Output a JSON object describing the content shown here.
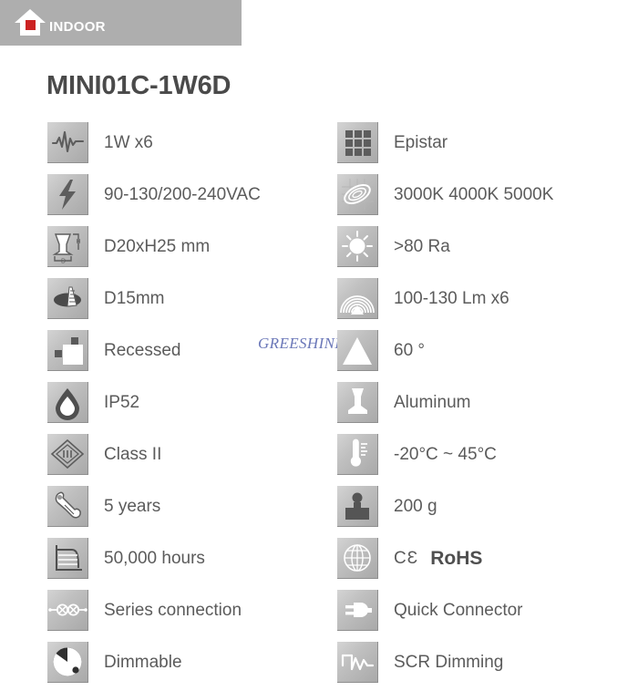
{
  "header": {
    "badge_label": "INDOOR",
    "badge_bg": "#aeaeae",
    "house_fill": "#ffffff",
    "house_accent": "#cc2222"
  },
  "title": "MINI01C-1W6D",
  "watermark": {
    "text": "GREESHINE",
    "color": "#6a77b8"
  },
  "specs": {
    "column_1": [
      {
        "icon": "waveform-icon",
        "label": "1W x6"
      },
      {
        "icon": "lightning-bolt-icon",
        "label": "90-130/200-240VAC"
      },
      {
        "icon": "dimensions-icon",
        "label": "D20xH25 mm"
      },
      {
        "icon": "cutout-hole-icon",
        "label": "D15mm"
      },
      {
        "icon": "recessed-mount-icon",
        "label": "Recessed"
      },
      {
        "icon": "water-drop-icon",
        "label": "IP52"
      },
      {
        "icon": "class-two-icon",
        "label": "Class II"
      },
      {
        "icon": "wrench-icon",
        "label": "5 years"
      },
      {
        "icon": "lifetime-graph-icon",
        "label": "50,000 hours"
      },
      {
        "icon": "series-circuit-icon",
        "label": "Series connection"
      },
      {
        "icon": "dimmer-knob-icon",
        "label": "Dimmable"
      }
    ],
    "column_2": [
      {
        "icon": "led-chip-grid-icon",
        "label": "Epistar"
      },
      {
        "icon": "color-temp-icon",
        "label": "3000K 4000K 5000K"
      },
      {
        "icon": "sun-cri-icon",
        "label": ">80 Ra"
      },
      {
        "icon": "luminous-flux-icon",
        "label": "100-130 Lm x6"
      },
      {
        "icon": "beam-angle-icon",
        "label": "60 °"
      },
      {
        "icon": "housing-material-icon",
        "label": "Aluminum"
      },
      {
        "icon": "thermometer-icon",
        "label": "-20°C ~ 45°C"
      },
      {
        "icon": "weight-icon",
        "label": "200 g"
      },
      {
        "icon": "globe-cert-icon",
        "label": "CE RoHS",
        "ce": "CƐ",
        "rohs": "RoHS"
      },
      {
        "icon": "plug-connector-icon",
        "label": "Quick Connector"
      },
      {
        "icon": "scr-wave-icon",
        "label": "SCR Dimming"
      }
    ]
  }
}
